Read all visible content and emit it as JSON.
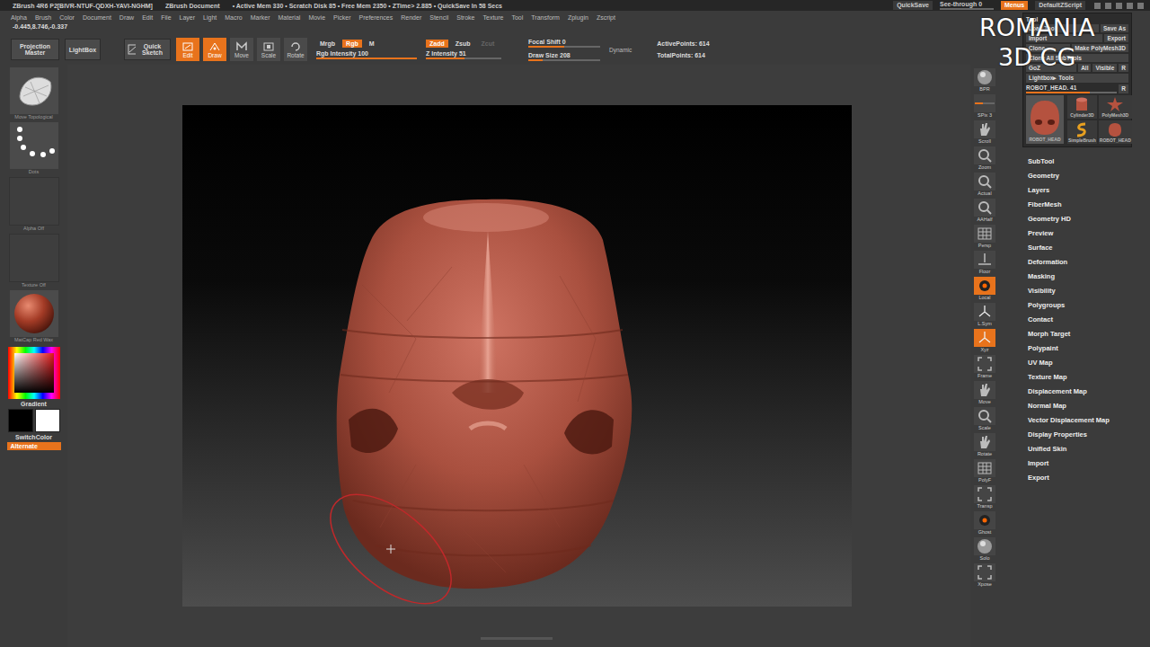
{
  "title_bar": {
    "app": "ZBrush 4R6 P2[BIVR-NTUF-QDXH-YAVI-NGHM]",
    "document": "ZBrush Document",
    "stats": "• Active Mem 330 • Scratch Disk 85 • Free Mem 2350 • ZTime> 2.885 • QuickSave In 58 Secs",
    "quicksave": "QuickSave",
    "see_through": {
      "label": "See-through",
      "value": "0",
      "level": 0
    },
    "menus": {
      "label": "Menus",
      "selected": true
    },
    "script": "DefaultZScript"
  },
  "menu": [
    "Alpha",
    "Brush",
    "Color",
    "Document",
    "Draw",
    "Edit",
    "File",
    "Layer",
    "Light",
    "Macro",
    "Marker",
    "Material",
    "Movie",
    "Picker",
    "Preferences",
    "Render",
    "Stencil",
    "Stroke",
    "Texture",
    "Tool",
    "Transform",
    "Zplugin",
    "Zscript"
  ],
  "coordinates": "-0.445,8.746,-0.337",
  "toolbar": {
    "projection_master": "Projection Master",
    "lightbox": "LightBox",
    "quick_sketch": "Quick Sketch",
    "modes": [
      {
        "label": "Edit",
        "kind": "edit",
        "selected": true
      },
      {
        "label": "Draw",
        "kind": "draw",
        "selected": true
      },
      {
        "label": "Move",
        "kind": "move",
        "selected": false
      },
      {
        "label": "Scale",
        "kind": "scale",
        "selected": false
      },
      {
        "label": "Rotate",
        "kind": "rotate",
        "selected": false
      }
    ],
    "color_modes": [
      {
        "label": "Mrgb",
        "selected": false,
        "disabled": false
      },
      {
        "label": "Rgb",
        "selected": true,
        "disabled": false
      },
      {
        "label": "M",
        "selected": false,
        "disabled": false
      }
    ],
    "rgb_intensity": {
      "label": "Rgb Intensity",
      "value": "100",
      "level": 1
    },
    "z_modes": [
      {
        "label": "Zadd",
        "selected": true,
        "disabled": false
      },
      {
        "label": "Zsub",
        "selected": false,
        "disabled": false
      },
      {
        "label": "Zcut",
        "selected": false,
        "disabled": true
      }
    ],
    "z_intensity": {
      "label": "Z Intensity",
      "value": "51",
      "level": 0.51
    },
    "focal_shift": {
      "label": "Focal Shift",
      "value": "0",
      "level": 0.5
    },
    "draw_size": {
      "label": "Draw Size",
      "value": "208",
      "level": 0.2
    },
    "dynamic": "Dynamic",
    "stats": [
      {
        "label": "ActivePoints:",
        "value": "614"
      },
      {
        "label": "TotalPoints:",
        "value": "614"
      }
    ]
  },
  "left_shelf": {
    "slots": [
      {
        "label": "Move Topological",
        "kind": "brush"
      },
      {
        "label": "Dots",
        "kind": "stroke"
      },
      {
        "label": "Alpha Off",
        "kind": "empty"
      },
      {
        "label": "Texture Off",
        "kind": "empty"
      },
      {
        "label": "MatCap Red Wax",
        "kind": "material"
      }
    ],
    "gradient": "Gradient",
    "swatches": [
      {
        "color": "#000000"
      },
      {
        "color": "#ffffff"
      }
    ],
    "switch_color": "SwitchColor",
    "alternate": {
      "label": "Alternate",
      "selected": true
    }
  },
  "right_shelf": [
    {
      "label": "BPR",
      "kind": "sphere",
      "selected": false,
      "level": 0
    },
    {
      "label": "SPix 3",
      "kind": "slider",
      "selected": false,
      "level": 0.4
    },
    {
      "label": "Scroll",
      "kind": "hand",
      "selected": false,
      "level": 0
    },
    {
      "label": "Zoom",
      "kind": "zoom",
      "selected": false,
      "level": 0
    },
    {
      "label": "Actual",
      "kind": "zoom",
      "selected": false,
      "level": 0
    },
    {
      "label": "AAHalf",
      "kind": "zoom",
      "selected": false,
      "level": 0
    },
    {
      "label": "Persp",
      "kind": "grid",
      "selected": false,
      "level": 0
    },
    {
      "label": "Floor",
      "kind": "floor",
      "selected": false,
      "level": 0
    },
    {
      "label": "Local",
      "kind": "local",
      "selected": true,
      "level": 0
    },
    {
      "label": "L.Sym",
      "kind": "axis",
      "selected": false,
      "level": 0
    },
    {
      "label": "Xyz",
      "kind": "axis",
      "selected": true,
      "level": 0
    },
    {
      "label": "Frame",
      "kind": "frame",
      "selected": false,
      "level": 0
    },
    {
      "label": "Move",
      "kind": "hand",
      "selected": false,
      "level": 0
    },
    {
      "label": "Scale",
      "kind": "zoom",
      "selected": false,
      "level": 0
    },
    {
      "label": "Rotate",
      "kind": "hand",
      "selected": false,
      "level": 0
    },
    {
      "label": "PolyF",
      "kind": "grid",
      "selected": false,
      "level": 0
    },
    {
      "label": "Transp",
      "kind": "frame",
      "selected": false,
      "level": 0
    },
    {
      "label": "Ghost",
      "kind": "local",
      "selected": false,
      "level": 0
    },
    {
      "label": "Solo",
      "kind": "sphere",
      "selected": false,
      "level": 0
    },
    {
      "label": "Xpose",
      "kind": "frame",
      "selected": false,
      "level": 0
    }
  ],
  "tool_palette": {
    "title": "Tool",
    "button_rows": [
      [
        "Load Tool",
        "Save As"
      ],
      [
        "Import",
        "Export"
      ],
      [
        "Clone",
        "Make PolyMesh3D"
      ]
    ],
    "clone_all": "Clone All SubTools",
    "goz_row": [
      "GoZ",
      "All",
      "Visible",
      "R"
    ],
    "lightbox": "Lightbox▸ Tools",
    "current": {
      "label": "ROBOT_HEAD. 41",
      "level": 0.7
    },
    "current_r": "R",
    "thumbnails": [
      {
        "label": "ROBOT_HEAD",
        "kind": "head",
        "selected": true
      },
      {
        "label": "Cylinder3D",
        "kind": "cylinder",
        "selected": false
      },
      {
        "label": "PolyMesh3D",
        "kind": "star",
        "selected": false
      },
      {
        "label": "SimpleBrush",
        "kind": "simplebrush",
        "selected": false
      },
      {
        "label": "ROBOT_HEAD",
        "kind": "head",
        "selected": false
      }
    ]
  },
  "sections": [
    "SubTool",
    "Geometry",
    "Layers",
    "FiberMesh",
    "Geometry HD",
    "Preview",
    "Surface",
    "Deformation",
    "Masking",
    "Visibility",
    "Polygroups",
    "Contact",
    "Morph Target",
    "Polypaint",
    "UV Map",
    "Texture Map",
    "Displacement Map",
    "Normal Map",
    "Vector Displacement Map",
    "Display Properties",
    "Unified Skin",
    "Import",
    "Export"
  ],
  "watermark": {
    "lines": [
      "ROMANIA",
      "3D CG"
    ]
  }
}
